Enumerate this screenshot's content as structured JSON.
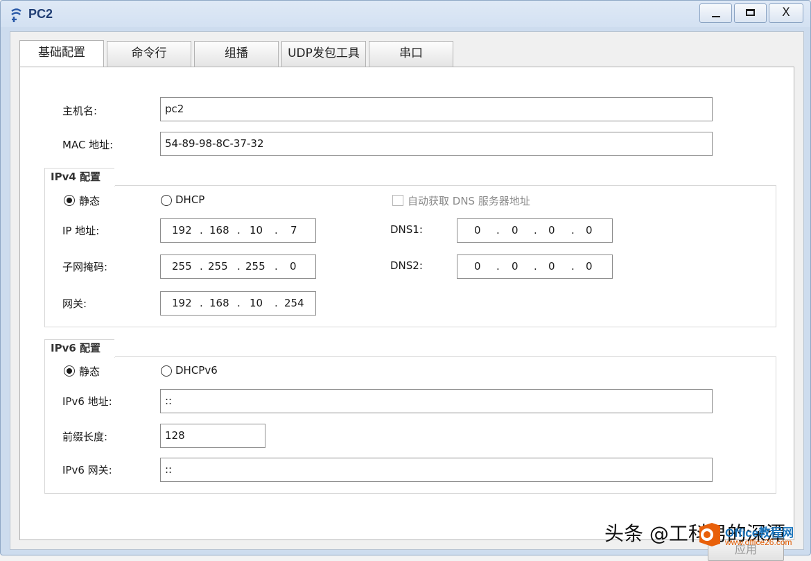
{
  "window": {
    "title": "PC2",
    "min_label": "",
    "max_label": "",
    "close_label": "X"
  },
  "tabs": [
    {
      "label": "基础配置"
    },
    {
      "label": "命令行"
    },
    {
      "label": "组播"
    },
    {
      "label": "UDP发包工具"
    },
    {
      "label": "串口"
    }
  ],
  "host": {
    "hostname_label": "主机名:",
    "hostname_value": "pc2",
    "mac_label": "MAC 地址:",
    "mac_value": "54-89-98-8C-37-32"
  },
  "ipv4": {
    "group_title": "IPv4 配置",
    "static_label": "静态",
    "dhcp_label": "DHCP",
    "auto_dns_label": "自动获取 DNS 服务器地址",
    "mode": "static",
    "ip_label": "IP 地址:",
    "ip": [
      "192",
      "168",
      "10",
      "7"
    ],
    "mask_label": "子网掩码:",
    "mask": [
      "255",
      "255",
      "255",
      "0"
    ],
    "gateway_label": "网关:",
    "gateway": [
      "192",
      "168",
      "10",
      "254"
    ],
    "dns1_label": "DNS1:",
    "dns1": [
      "0",
      "0",
      "0",
      "0"
    ],
    "dns2_label": "DNS2:",
    "dns2": [
      "0",
      "0",
      "0",
      "0"
    ]
  },
  "ipv6": {
    "group_title": "IPv6 配置",
    "static_label": "静态",
    "dhcp_label": "DHCPv6",
    "mode": "static",
    "addr_label": "IPv6 地址:",
    "addr_value": "::",
    "prefix_label": "前缀长度:",
    "prefix_value": "128",
    "gateway_label": "IPv6 网关:",
    "gateway_value": "::"
  },
  "actions": {
    "apply_label": "应用"
  },
  "overlay": {
    "watermark_text": "头条 @工科男的深潭",
    "site_name": "Office教程网",
    "site_url": "www.office26.com"
  }
}
